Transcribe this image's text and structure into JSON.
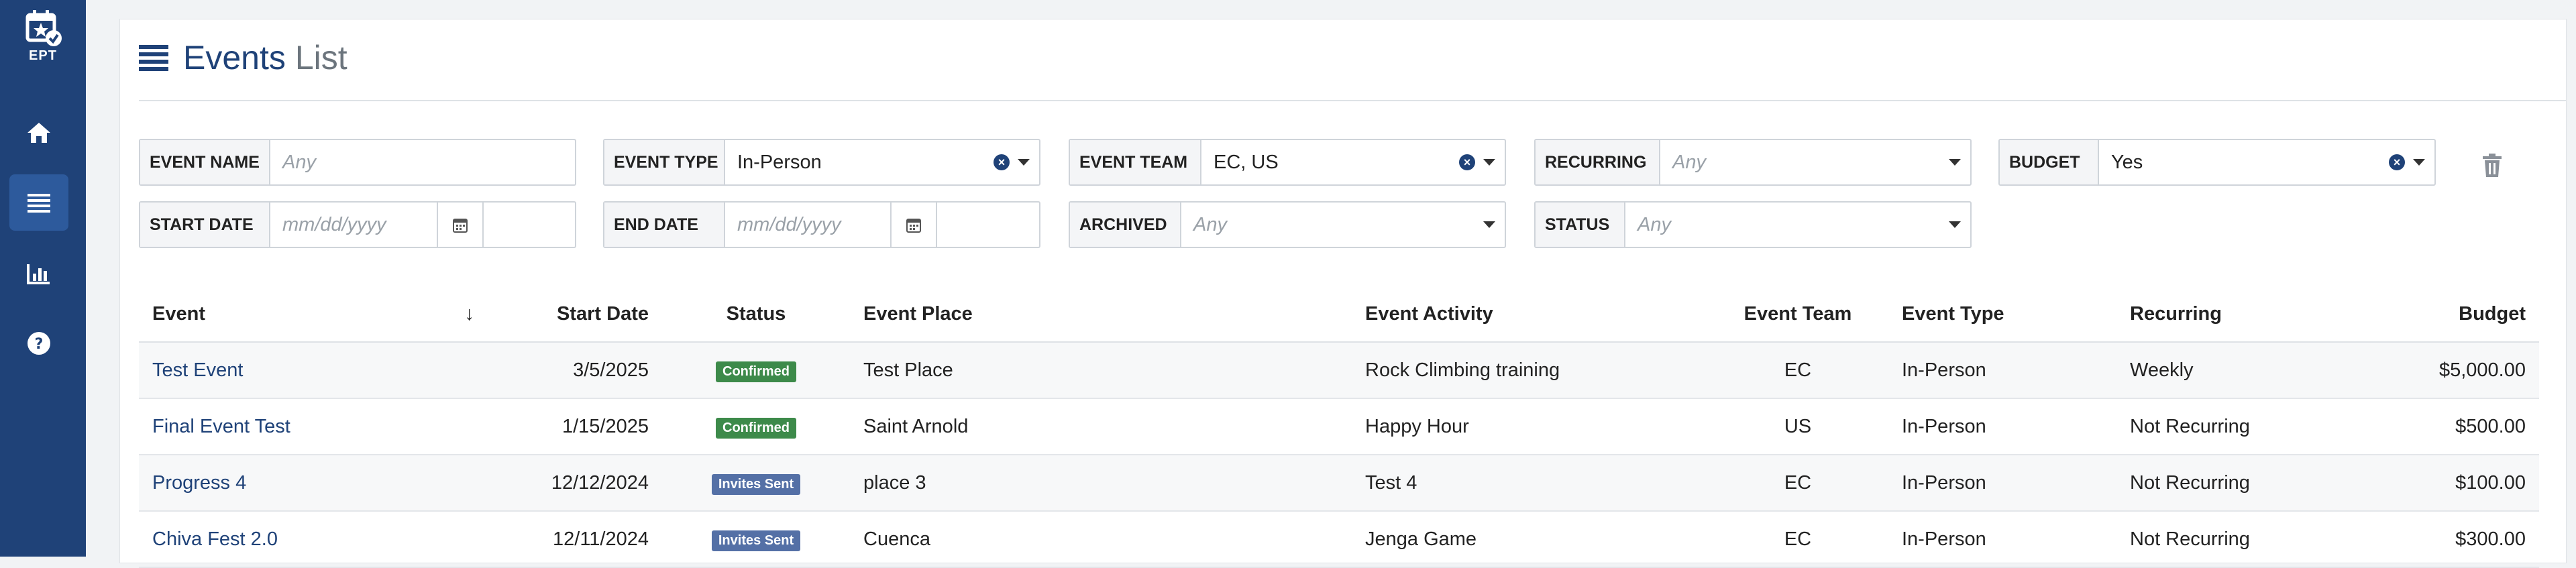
{
  "app": {
    "logo_text": "EPT"
  },
  "sidebar": {
    "items": [
      {
        "name": "home",
        "icon": "home-icon",
        "active": false
      },
      {
        "name": "list",
        "icon": "list-icon",
        "active": true
      },
      {
        "name": "reports",
        "icon": "chart-icon",
        "active": false
      },
      {
        "name": "help",
        "icon": "help-icon",
        "active": false
      }
    ]
  },
  "header": {
    "title_main": "Events",
    "title_sub": "List"
  },
  "filters": {
    "event_name": {
      "label": "EVENT NAME",
      "placeholder": "Any"
    },
    "event_type": {
      "label": "EVENT TYPE",
      "value": "In-Person"
    },
    "event_team": {
      "label": "EVENT TEAM",
      "value": "EC, US"
    },
    "recurring": {
      "label": "RECURRING",
      "placeholder": "Any"
    },
    "budget": {
      "label": "BUDGET",
      "value": "Yes"
    },
    "start_date": {
      "label": "START DATE",
      "placeholder": "mm/dd/yyyy"
    },
    "end_date": {
      "label": "END DATE",
      "placeholder": "mm/dd/yyyy"
    },
    "archived": {
      "label": "ARCHIVED",
      "placeholder": "Any"
    },
    "status": {
      "label": "STATUS",
      "placeholder": "Any"
    }
  },
  "table": {
    "headers": {
      "event": "Event",
      "start_date": "Start Date",
      "status": "Status",
      "event_place": "Event Place",
      "event_activity": "Event Activity",
      "event_team": "Event Team",
      "event_type": "Event Type",
      "recurring": "Recurring",
      "budget": "Budget"
    },
    "sort_indicator": "↓",
    "rows": [
      {
        "event": "Test Event",
        "start_date": "3/5/2025",
        "status": "Confirmed",
        "place": "Test Place",
        "activity": "Rock Climbing training",
        "team": "EC",
        "type": "In-Person",
        "recurring": "Weekly",
        "budget": "$5,000.00"
      },
      {
        "event": "Final Event Test",
        "start_date": "1/15/2025",
        "status": "Confirmed",
        "place": "Saint Arnold",
        "activity": "Happy Hour",
        "team": "US",
        "type": "In-Person",
        "recurring": "Not Recurring",
        "budget": "$500.00"
      },
      {
        "event": "Progress 4",
        "start_date": "12/12/2024",
        "status": "Invites Sent",
        "place": "place 3",
        "activity": "Test 4",
        "team": "EC",
        "type": "In-Person",
        "recurring": "Not Recurring",
        "budget": "$100.00"
      },
      {
        "event": "Chiva Fest 2.0",
        "start_date": "12/11/2024",
        "status": "Invites Sent",
        "place": "Cuenca",
        "activity": "Jenga Game",
        "team": "EC",
        "type": "In-Person",
        "recurring": "Not Recurring",
        "budget": "$300.00"
      }
    ]
  },
  "colors": {
    "sidebar": "#1f4278",
    "sidebar_active": "#2d5a9c",
    "confirmed": "#3d8a4a",
    "invites_sent": "#5470a6",
    "link": "#1f4278"
  }
}
